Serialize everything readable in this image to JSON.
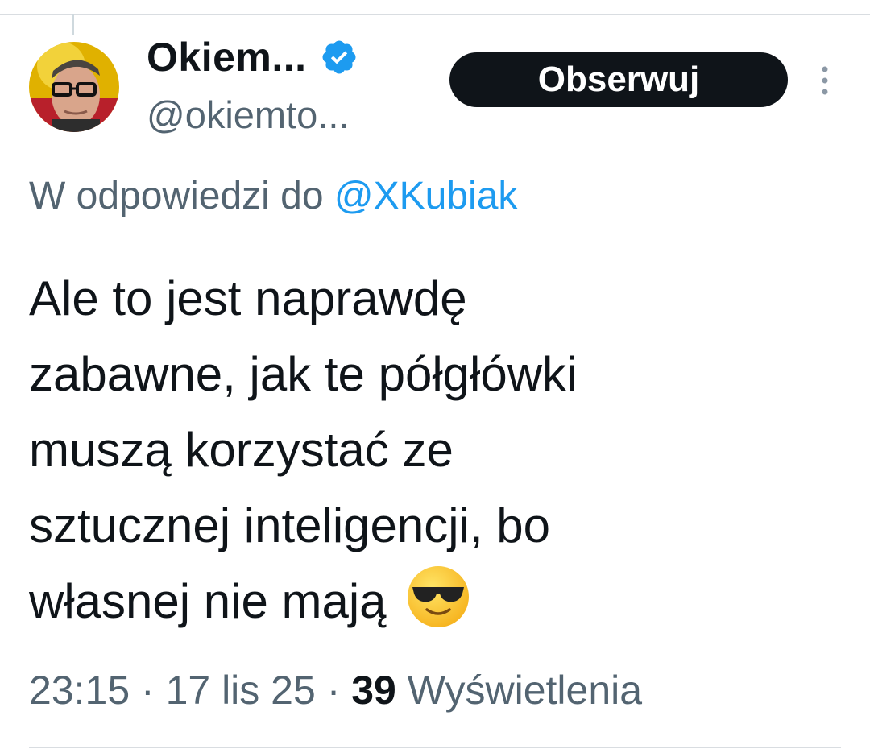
{
  "author": {
    "display_name": "Okiem...",
    "handle": "@okiemto...",
    "verified": true,
    "verified_color": "#1d9bf0"
  },
  "follow_button": {
    "label": "Obserwuj"
  },
  "more_menu": {
    "icon": "more-vertical-icon"
  },
  "reply_context": {
    "prefix": "W odpowiedzi do ",
    "mention": "@XKubiak",
    "mention_color": "#1d9bf0"
  },
  "tweet": {
    "lines": [
      "Ale to jest naprawdę",
      "zabawne, jak te półgłówki",
      "muszą korzystać ze",
      "sztucznej inteligencji, bo",
      "własnej nie mają"
    ],
    "emoji": "smiling-face-with-sunglasses-icon"
  },
  "meta": {
    "time": "23:15",
    "separator": " · ",
    "date": "17 lis 25",
    "views_count": "39",
    "views_label": " Wyświetlenia"
  }
}
